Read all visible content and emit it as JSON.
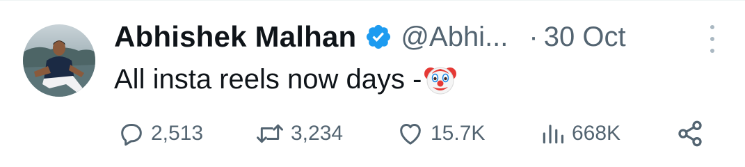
{
  "tweet": {
    "author_name": "Abhishek Malhan",
    "handle": "@Abhi...",
    "separator": "·",
    "date": "30 Oct",
    "text": "All insta reels now days -",
    "emoji": "clown-face-emoji"
  },
  "actions": {
    "reply_count": "2,513",
    "retweet_count": "3,234",
    "like_count": "15.7K",
    "view_count": "668K"
  },
  "icons": {
    "reply": "reply-icon",
    "retweet": "retweet-icon",
    "like": "heart-icon",
    "views": "views-icon",
    "share": "share-icon",
    "verified": "verified-badge-icon",
    "more": "more-options-icon"
  },
  "colors": {
    "text": "#0f1419",
    "secondary": "#536471",
    "verified": "#1d9bf0"
  }
}
